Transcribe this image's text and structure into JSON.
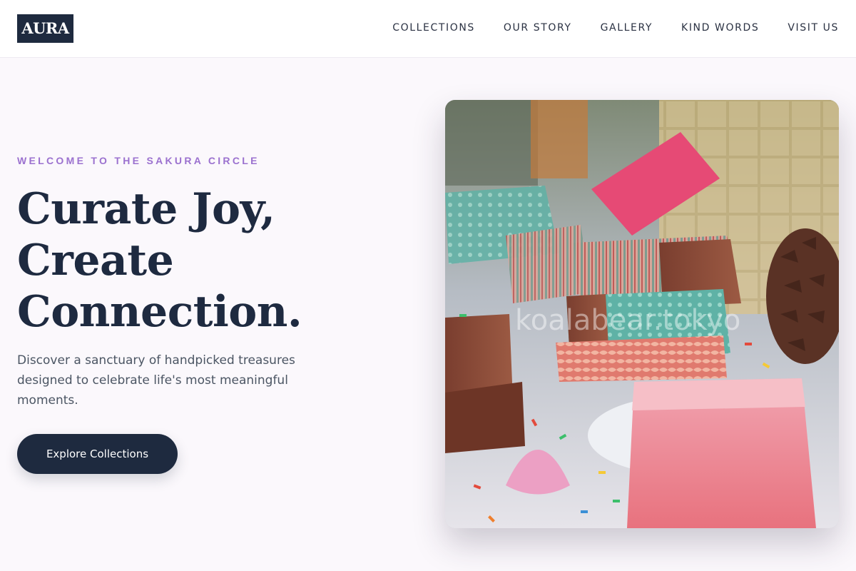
{
  "header": {
    "logo_text": "AURA",
    "nav": [
      {
        "label": "COLLECTIONS"
      },
      {
        "label": "OUR STORY"
      },
      {
        "label": "GALLERY"
      },
      {
        "label": "KIND WORDS"
      },
      {
        "label": "VISIT US"
      }
    ]
  },
  "hero": {
    "eyebrow": "WELCOME TO THE SAKURA CIRCLE",
    "headline_lines": [
      "Curate Joy,",
      "Create",
      "Connection."
    ],
    "lead": "Discover a sanctuary of handpicked treasures designed to celebrate life's most meaningful moments.",
    "cta_label": "Explore Collections"
  },
  "image": {
    "watermark": "koalabear.tokyo",
    "subject": "handmade soap bars wrapped in patterned paper with sprinkles and a pinecone"
  },
  "colors": {
    "brand_dark": "#1e2a3f",
    "accent_purple": "#9b71cf",
    "page_bg": "#fbf8fc"
  }
}
